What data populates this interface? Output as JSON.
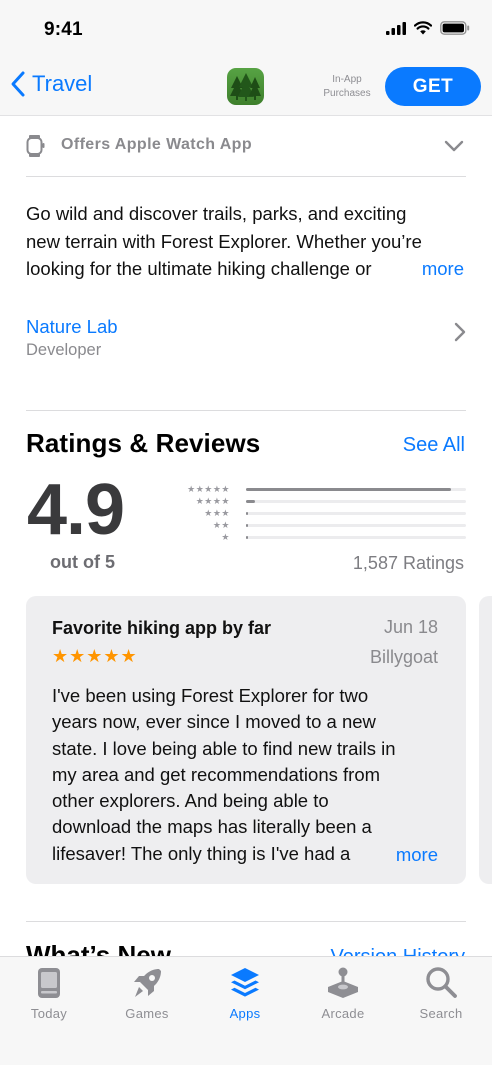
{
  "status_bar": {
    "time": "9:41"
  },
  "nav": {
    "back_label": "Travel",
    "iap_line1": "In-App",
    "iap_line2": "Purchases",
    "get_label": "GET"
  },
  "watch": {
    "label": "Offers Apple Watch App"
  },
  "description": {
    "lines": [
      "Go wild and discover trails, parks, and exciting",
      "new terrain with Forest Explorer. Whether you’re",
      "looking for the ultimate hiking challenge or"
    ],
    "more": "more"
  },
  "developer": {
    "name": "Nature Lab",
    "label": "Developer"
  },
  "ratings": {
    "title": "Ratings & Reviews",
    "see_all": "See All",
    "score": "4.9",
    "out_of": "out of 5",
    "count": "1,587 Ratings",
    "histogram": [
      {
        "stars": "★★★★★",
        "fraction": 0.93
      },
      {
        "stars": "★★★★",
        "fraction": 0.04
      },
      {
        "stars": "★★★",
        "fraction": 0.01
      },
      {
        "stars": "★★",
        "fraction": 0.005
      },
      {
        "stars": "★",
        "fraction": 0.005
      }
    ]
  },
  "review": {
    "title": "Favorite hiking app by far",
    "date": "Jun 18",
    "author": "Billygoat",
    "stars": "★★★★★",
    "rating": 5,
    "lines": [
      "I've been using Forest Explorer for two",
      "years now, ever since I moved to a new",
      "state. I love being able to find new trails in",
      "my area and get recommendations from",
      "other explorers. And being able to",
      "download the maps has literally been a",
      "lifesaver! The only thing is I've had a"
    ],
    "more": "more"
  },
  "whats_new": {
    "title": "What’s New",
    "version_history": "Version History"
  },
  "tabs": [
    {
      "label": "Today",
      "icon": "today-icon",
      "active": false
    },
    {
      "label": "Games",
      "icon": "rocket-icon",
      "active": false
    },
    {
      "label": "Apps",
      "icon": "apps-stack-icon",
      "active": true
    },
    {
      "label": "Arcade",
      "icon": "joystick-icon",
      "active": false
    },
    {
      "label": "Search",
      "icon": "search-icon",
      "active": false
    }
  ],
  "colors": {
    "accent": "#0a7aff",
    "star": "#ff9500",
    "icon_green": "#4e9a3a"
  }
}
